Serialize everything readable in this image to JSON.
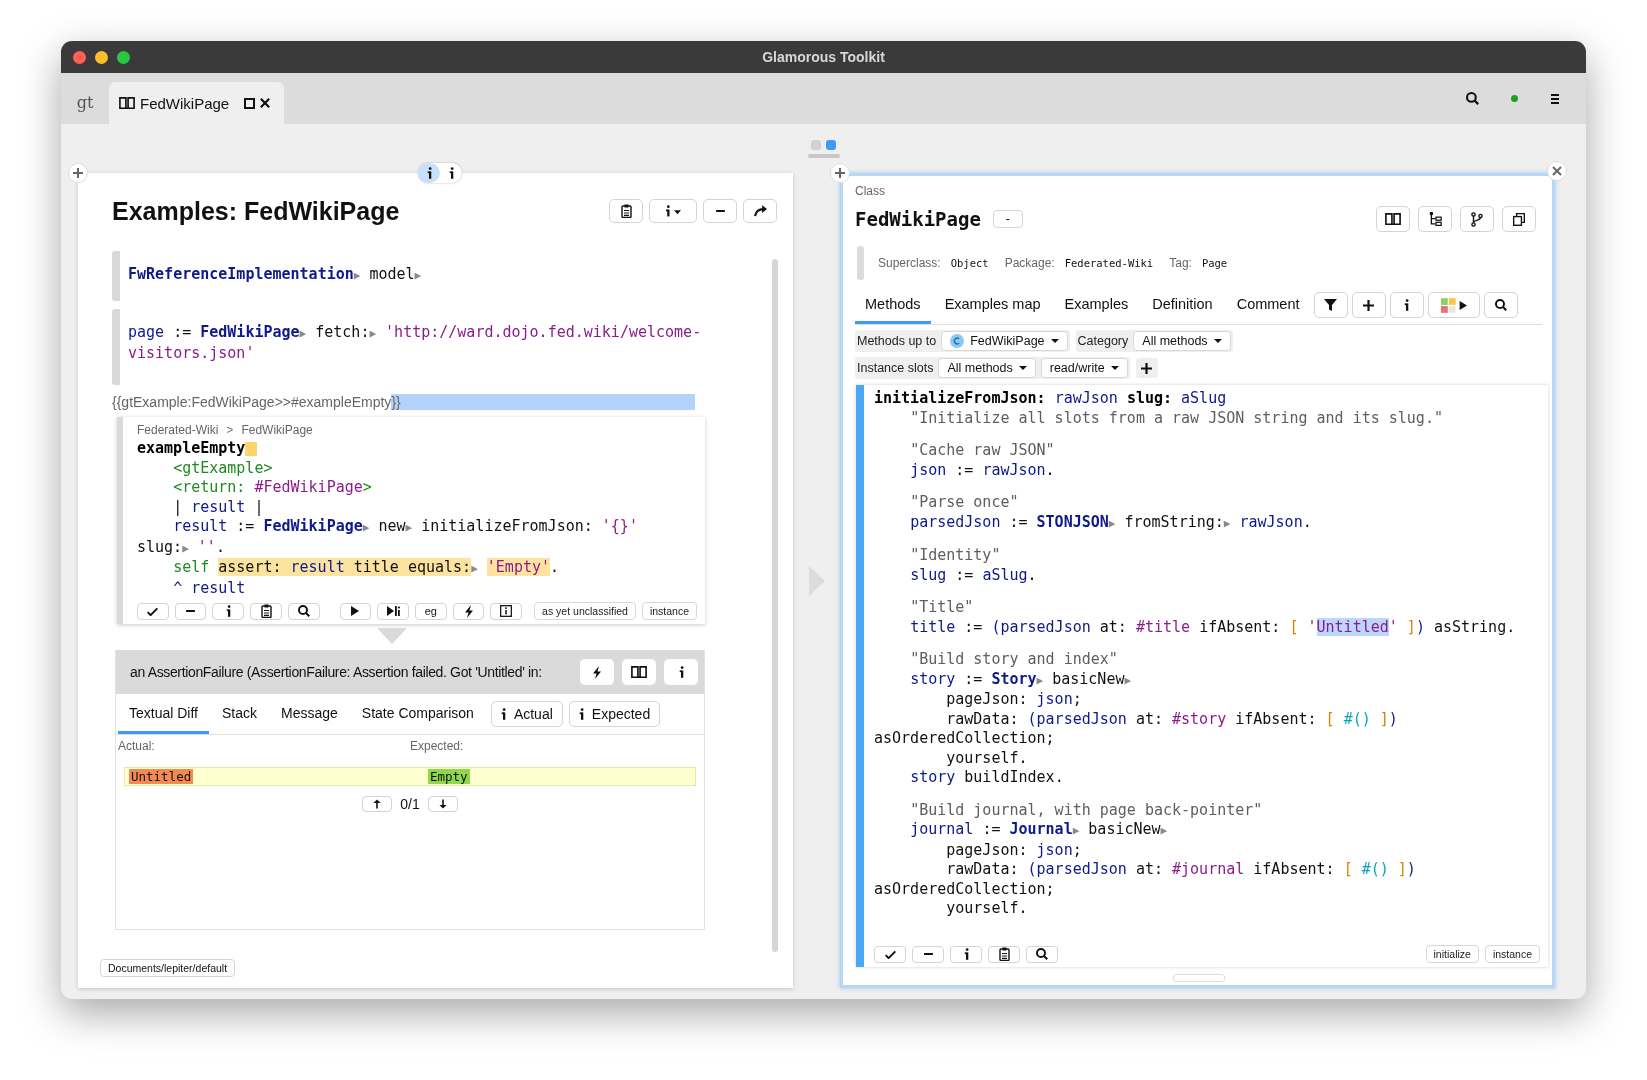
{
  "window": {
    "title": "Glamorous Toolkit"
  },
  "tab_bar": {
    "logo": "gt",
    "tabs": [
      {
        "label": "FedWikiPage",
        "selected": true
      }
    ]
  },
  "pager": {
    "pages": [
      {
        "selected": false
      },
      {
        "selected": true
      }
    ]
  },
  "left_pane": {
    "view_toggles": [
      {
        "selected": true
      },
      {
        "selected": false
      }
    ],
    "title": "Examples: FedWikiPage",
    "snippets": [
      {
        "lines": [
          {
            "text": "FwReferenceImplementation▶ model▶"
          }
        ]
      },
      {
        "lines": [
          {
            "text": "page := FedWikiPage▶ fetch:▶ 'http://ward.dojo.fed.wiki/welcome-"
          },
          {
            "text": "visitors.json'"
          }
        ]
      }
    ],
    "reference": {
      "text": "{{gtExample:FedWikiPage>>#exampleEmpty",
      "selected_text": "}}"
    },
    "example": {
      "breadcrumb": [
        "Federated-Wiki",
        "FedWikiPage"
      ],
      "separator": ">",
      "lines": [
        {
          "text": "exampleEmpty"
        },
        {
          "text": "    <gtExample>"
        },
        {
          "text": "    <return: #FedWikiPage>"
        },
        {
          "text": "    | result |"
        },
        {
          "text": "    result := FedWikiPage▶ new▶ initializeFromJson: '{}'"
        },
        {
          "text": "slug:▶ ''."
        },
        {
          "segments": [
            {
              "text": "    self ",
              "highlighted": false
            },
            {
              "text": "assert: result title equals:",
              "highlighted": true
            },
            {
              "text": "▶ ",
              "highlighted": false
            },
            {
              "text": "'Empty'",
              "highlighted": true
            },
            {
              "text": ".",
              "highlighted": false
            }
          ]
        },
        {
          "text": "    ^ result"
        }
      ],
      "eg_button": "eg",
      "tags": [
        "as yet unclassified",
        "instance"
      ]
    },
    "failure": {
      "message": "an AssertionFailure (AssertionFailure: Assertion failed. Got 'Untitled' in:",
      "tabs": [
        {
          "label": "Textual Diff",
          "selected": true
        },
        {
          "label": "Stack",
          "selected": false
        },
        {
          "label": "Message",
          "selected": false
        },
        {
          "label": "State Comparison",
          "selected": false
        }
      ],
      "inspect_buttons": [
        "Actual",
        "Expected"
      ],
      "actual_label": "Actual:",
      "expected_label": "Expected:",
      "actual": "Untitled",
      "expected": "Empty",
      "position": "0/1"
    },
    "path": "Documents/lepiter/default"
  },
  "right_pane": {
    "kind": "Class",
    "name": "FedWikiPage",
    "name_button": "-",
    "info": [
      {
        "label": "Superclass:",
        "value": "Object"
      },
      {
        "label": "Package:",
        "value": "Federated-Wiki"
      },
      {
        "label": "Tag:",
        "value": "Page"
      }
    ],
    "tabs": [
      {
        "label": "Methods",
        "selected": true
      },
      {
        "label": "Examples map",
        "selected": false
      },
      {
        "label": "Examples",
        "selected": false
      },
      {
        "label": "Definition",
        "selected": false
      },
      {
        "label": "Comment",
        "selected": false
      }
    ],
    "filters": {
      "methods_up_to": {
        "label": "Methods up to",
        "value": "FedWikiPage"
      },
      "category": {
        "label": "Category",
        "value": "All methods"
      },
      "instance_slots": {
        "label": "Instance slots",
        "values": [
          "All methods",
          "read/write"
        ]
      }
    },
    "code": [
      {
        "lines": [
          {
            "text": "initializeFromJson: rawJson slug: aSlug"
          },
          {
            "text": "    \"Initialize all slots from a raw JSON string and its slug.\""
          }
        ]
      },
      {
        "lines": [
          {
            "text": "    \"Cache raw JSON\""
          },
          {
            "text": "    json := rawJson."
          }
        ]
      },
      {
        "lines": [
          {
            "text": "    \"Parse once\""
          },
          {
            "text": "    parsedJson := STONJSON▶ fromString:▶ rawJson."
          }
        ]
      },
      {
        "lines": [
          {
            "text": "    \"Identity\""
          },
          {
            "text": "    slug := aSlug."
          }
        ]
      },
      {
        "lines": [
          {
            "text": "    \"Title\""
          },
          {
            "segments": [
              {
                "text": "    title := (parsedJson at: #title ifAbsent: [ '",
                "selected": false
              },
              {
                "text": "Untitled",
                "selected": true
              },
              {
                "text": "' ]) asString.",
                "selected": false
              }
            ]
          }
        ]
      },
      {
        "lines": [
          {
            "text": "    \"Build story and index\""
          },
          {
            "text": "    story := Story▶ basicNew▶"
          },
          {
            "text": "        pageJson: json;"
          },
          {
            "text": "        rawData: (parsedJson at: #story ifAbsent: [ #() ])"
          },
          {
            "text": "asOrderedCollection;"
          },
          {
            "text": "        yourself."
          },
          {
            "text": "    story buildIndex."
          }
        ]
      },
      {
        "lines": [
          {
            "text": "    \"Build journal, with page back-pointer\""
          },
          {
            "text": "    journal := Journal▶ basicNew▶"
          },
          {
            "text": "        pageJson: json;"
          },
          {
            "text": "        rawData: (parsedJson at: #journal ifAbsent: [ #() ])"
          },
          {
            "text": "asOrderedCollection;"
          },
          {
            "text": "        yourself."
          }
        ]
      }
    ],
    "tags": [
      "initialize",
      "instance"
    ]
  }
}
